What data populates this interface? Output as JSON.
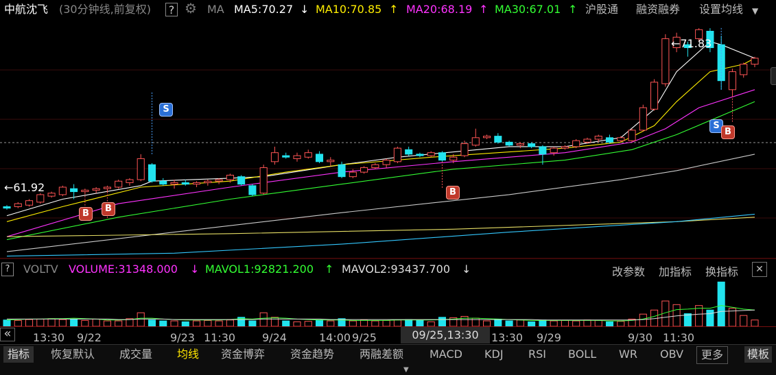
{
  "header": {
    "stock_name": "中航沈飞",
    "period_info": "(30分钟线,前复权)",
    "help": "?",
    "indicator": "MA",
    "ma5": "MA5:70.27",
    "ma10": "MA10:70.85",
    "ma20": "MA20:68.19",
    "ma30": "MA30:67.01",
    "link_hgt": "沪股通",
    "link_margin": "融资融券",
    "link_setma": "设置均线"
  },
  "price_labels": {
    "high": "71.83",
    "low": "61.92"
  },
  "signals": {
    "s": "S",
    "b": "B"
  },
  "vol_header": {
    "help": "?",
    "name": "VOLTV",
    "volume": "VOLUME:31348.000",
    "mavol1": "MAVOL1:92821.200",
    "mavol2": "MAVOL2:93437.700",
    "edit_params": "改参数",
    "add_indicator": "加指标",
    "switch_indicator": "换指标",
    "close": "✕"
  },
  "x_axis": {
    "nav": "«",
    "labels": [
      "13:30",
      "9/22",
      "9/23",
      "11:30",
      "9/24",
      "14:00",
      "9/25",
      "13:30",
      "9/29",
      "9/30",
      "11:30"
    ],
    "cursor": "09/25,13:30"
  },
  "bottom_tabs": [
    "指标",
    "恢复默认",
    "成交量",
    "均线",
    "资金博弈",
    "资金趋势",
    "两融差额",
    "MACD",
    "KDJ",
    "RSI",
    "BOLL",
    "WR",
    "OBV",
    "更多",
    "模板"
  ],
  "colors": {
    "up": "#ff5555",
    "down": "#22e3ee",
    "ma5": "#ffffff",
    "ma10": "#ffee00",
    "ma20": "#ff33ff",
    "ma30": "#33ff33",
    "tab_active": "#ffe600"
  },
  "chart_data": {
    "type": "candlestick",
    "price_range": [
      58.5,
      74.5
    ],
    "candles": [
      [
        62.0,
        62.1,
        61.8,
        61.9
      ],
      [
        62.0,
        62.3,
        61.9,
        62.2
      ],
      [
        62.1,
        62.5,
        62.0,
        62.4
      ],
      [
        62.3,
        62.9,
        62.2,
        62.8
      ],
      [
        62.7,
        63.0,
        62.6,
        62.9
      ],
      [
        62.8,
        63.4,
        62.7,
        63.3
      ],
      [
        63.2,
        63.5,
        62.5,
        63.0
      ],
      [
        63.0,
        63.2,
        62.9,
        63.1
      ],
      [
        63.1,
        63.3,
        62.9,
        63.2
      ],
      [
        63.2,
        63.4,
        63.0,
        63.3
      ],
      [
        63.3,
        63.8,
        63.2,
        63.7
      ],
      [
        63.6,
        63.9,
        63.4,
        63.8
      ],
      [
        63.8,
        65.5,
        63.7,
        65.2
      ],
      [
        64.8,
        64.9,
        63.6,
        63.7
      ],
      [
        63.7,
        63.9,
        63.4,
        63.5
      ],
      [
        63.5,
        63.8,
        63.2,
        63.6
      ],
      [
        63.6,
        63.8,
        63.4,
        63.5
      ],
      [
        63.5,
        63.7,
        63.3,
        63.6
      ],
      [
        63.6,
        63.8,
        63.4,
        63.7
      ],
      [
        63.7,
        63.9,
        63.5,
        63.8
      ],
      [
        63.8,
        64.2,
        63.6,
        64.1
      ],
      [
        64.0,
        64.1,
        63.4,
        63.5
      ],
      [
        63.4,
        63.5,
        62.7,
        62.8
      ],
      [
        62.9,
        64.8,
        62.8,
        64.6
      ],
      [
        65.0,
        66.0,
        64.8,
        65.6
      ],
      [
        65.4,
        65.6,
        65.2,
        65.3
      ],
      [
        65.2,
        65.6,
        65.0,
        65.4
      ],
      [
        65.3,
        65.8,
        65.2,
        65.6
      ],
      [
        65.5,
        65.7,
        64.9,
        65.0
      ],
      [
        65.0,
        65.3,
        64.7,
        65.1
      ],
      [
        64.8,
        65.0,
        63.9,
        64.0
      ],
      [
        64.0,
        64.5,
        63.9,
        64.3
      ],
      [
        64.3,
        64.7,
        64.2,
        64.6
      ],
      [
        64.6,
        64.9,
        64.5,
        64.8
      ],
      [
        64.8,
        65.2,
        64.6,
        65.1
      ],
      [
        65.0,
        66.0,
        64.9,
        65.9
      ],
      [
        65.8,
        66.0,
        65.4,
        65.5
      ],
      [
        65.5,
        65.6,
        65.3,
        65.4
      ],
      [
        65.4,
        65.7,
        65.3,
        65.6
      ],
      [
        65.6,
        65.7,
        65.0,
        65.1
      ],
      [
        65.1,
        65.5,
        64.9,
        65.3
      ],
      [
        65.4,
        66.4,
        65.3,
        66.2
      ],
      [
        66.1,
        67.2,
        66.0,
        66.6
      ],
      [
        66.6,
        66.8,
        66.5,
        66.7
      ],
      [
        66.7,
        66.9,
        66.2,
        66.3
      ],
      [
        66.3,
        66.4,
        66.0,
        66.1
      ],
      [
        66.1,
        66.3,
        65.9,
        66.2
      ],
      [
        66.2,
        66.3,
        65.9,
        66.0
      ],
      [
        66.0,
        66.1,
        64.8,
        65.5
      ],
      [
        65.6,
        66.0,
        65.4,
        65.9
      ],
      [
        65.9,
        66.1,
        65.8,
        66.0
      ],
      [
        66.0,
        66.5,
        65.9,
        66.4
      ],
      [
        66.3,
        66.6,
        66.2,
        66.5
      ],
      [
        66.5,
        66.8,
        66.3,
        66.7
      ],
      [
        66.6,
        66.8,
        66.2,
        66.3
      ],
      [
        66.4,
        66.7,
        66.3,
        66.6
      ],
      [
        66.4,
        67.2,
        66.3,
        67.1
      ],
      [
        67.1,
        68.8,
        67.0,
        68.6
      ],
      [
        68.5,
        70.5,
        68.4,
        70.3
      ],
      [
        70.2,
        73.5,
        70.0,
        73.2
      ],
      [
        72.6,
        73.6,
        72.3,
        73.3
      ],
      [
        72.8,
        73.0,
        72.0,
        72.6
      ],
      [
        73.2,
        73.9,
        73.0,
        73.8
      ],
      [
        73.7,
        73.9,
        72.3,
        72.6
      ],
      [
        72.8,
        73.4,
        69.8,
        70.4
      ],
      [
        69.8,
        71.2,
        69.4,
        71.0
      ],
      [
        70.8,
        71.6,
        70.6,
        71.5
      ],
      [
        71.5,
        72.0,
        71.3,
        71.9
      ]
    ],
    "signals": [
      {
        "type": "S",
        "index": 13,
        "price": 65.5
      },
      {
        "type": "B",
        "index": 7,
        "price": 62.9
      },
      {
        "type": "B",
        "index": 9,
        "price": 63.0
      },
      {
        "type": "B",
        "index": 39,
        "price": 65.0
      },
      {
        "type": "S",
        "index": 64,
        "price": 69.8
      },
      {
        "type": "B",
        "index": 65,
        "price": 69.4
      }
    ],
    "ma_lines": {
      "ma5": [
        [
          0,
          61.4
        ],
        [
          5,
          62.5
        ],
        [
          12,
          63.4
        ],
        [
          13,
          63.7
        ],
        [
          20,
          63.9
        ],
        [
          23,
          64.0
        ],
        [
          30,
          64.8
        ],
        [
          35,
          65.3
        ],
        [
          45,
          66.0
        ],
        [
          50,
          66.0
        ],
        [
          55,
          66.6
        ],
        [
          58,
          68.5
        ],
        [
          60,
          71.0
        ],
        [
          63,
          73.0
        ],
        [
          64,
          72.8
        ],
        [
          67,
          71.9
        ]
      ],
      "ma10": [
        [
          0,
          61.0
        ],
        [
          5,
          62.0
        ],
        [
          12,
          63.3
        ],
        [
          20,
          63.7
        ],
        [
          25,
          64.3
        ],
        [
          30,
          64.8
        ],
        [
          38,
          65.3
        ],
        [
          50,
          65.9
        ],
        [
          55,
          66.3
        ],
        [
          58,
          67.4
        ],
        [
          60,
          69.0
        ],
        [
          63,
          71.0
        ],
        [
          66,
          71.5
        ],
        [
          67,
          71.9
        ]
      ],
      "ma20": [
        [
          0,
          60.0
        ],
        [
          10,
          62.2
        ],
        [
          20,
          63.3
        ],
        [
          30,
          64.3
        ],
        [
          40,
          65.0
        ],
        [
          50,
          65.6
        ],
        [
          56,
          66.3
        ],
        [
          59,
          67.2
        ],
        [
          62,
          68.6
        ],
        [
          67,
          69.8
        ]
      ],
      "ma30": [
        [
          0,
          59.8
        ],
        [
          10,
          61.3
        ],
        [
          20,
          62.5
        ],
        [
          30,
          63.5
        ],
        [
          40,
          64.5
        ],
        [
          50,
          65.1
        ],
        [
          56,
          65.8
        ],
        [
          60,
          66.8
        ],
        [
          67,
          69.0
        ]
      ],
      "ma60": [
        [
          0,
          59.0
        ],
        [
          15,
          60.3
        ],
        [
          30,
          61.6
        ],
        [
          45,
          62.8
        ],
        [
          55,
          63.8
        ],
        [
          60,
          64.4
        ],
        [
          67,
          65.5
        ]
      ],
      "ma120": [
        [
          0,
          60.0
        ],
        [
          20,
          60.2
        ],
        [
          40,
          60.5
        ],
        [
          60,
          61.0
        ],
        [
          67,
          61.3
        ]
      ],
      "ma250": [
        [
          0,
          58.7
        ],
        [
          15,
          58.9
        ],
        [
          30,
          59.5
        ],
        [
          45,
          60.3
        ],
        [
          60,
          61.0
        ],
        [
          67,
          61.5
        ]
      ]
    },
    "ma_colors": {
      "ma5": "#ffffff",
      "ma10": "#ffee00",
      "ma20": "#ff33ff",
      "ma30": "#33ff33",
      "ma60": "#cccccc",
      "ma120": "#e8e066",
      "ma250": "#33c8ff"
    },
    "volume": [
      0.14,
      0.13,
      0.15,
      0.16,
      0.17,
      0.15,
      0.16,
      0.13,
      0.16,
      0.12,
      0.12,
      0.17,
      0.3,
      0.14,
      0.12,
      0.12,
      0.1,
      0.12,
      0.13,
      0.12,
      0.14,
      0.2,
      0.12,
      0.3,
      0.2,
      0.12,
      0.1,
      0.11,
      0.14,
      0.12,
      0.17,
      0.12,
      0.14,
      0.12,
      0.13,
      0.14,
      0.15,
      0.13,
      0.1,
      0.2,
      0.19,
      0.22,
      0.18,
      0.12,
      0.16,
      0.12,
      0.14,
      0.1,
      0.14,
      0.12,
      0.13,
      0.12,
      0.14,
      0.13,
      0.1,
      0.11,
      0.16,
      0.27,
      0.36,
      0.56,
      0.48,
      0.28,
      0.46,
      0.36,
      0.98,
      0.4,
      0.24,
      0.14
    ],
    "mavol1": [
      0.14,
      0.15,
      0.16,
      0.16,
      0.17,
      0.17,
      0.18,
      0.17,
      0.16,
      0.14,
      0.14,
      0.15,
      0.18,
      0.18,
      0.16,
      0.15,
      0.14,
      0.14,
      0.14,
      0.14,
      0.15,
      0.17,
      0.16,
      0.18,
      0.19,
      0.18,
      0.16,
      0.15,
      0.14,
      0.14,
      0.14,
      0.13,
      0.13,
      0.13,
      0.13,
      0.14,
      0.14,
      0.14,
      0.14,
      0.15,
      0.16,
      0.18,
      0.18,
      0.17,
      0.16,
      0.15,
      0.14,
      0.13,
      0.13,
      0.13,
      0.13,
      0.13,
      0.13,
      0.13,
      0.12,
      0.12,
      0.13,
      0.16,
      0.22,
      0.3,
      0.37,
      0.38,
      0.4,
      0.4,
      0.46,
      0.42,
      0.38,
      0.36
    ],
    "mavol2": [
      0.16,
      0.16,
      0.16,
      0.16,
      0.16,
      0.16,
      0.16,
      0.16,
      0.16,
      0.16,
      0.15,
      0.15,
      0.16,
      0.16,
      0.16,
      0.15,
      0.15,
      0.15,
      0.15,
      0.15,
      0.15,
      0.15,
      0.15,
      0.16,
      0.16,
      0.16,
      0.16,
      0.16,
      0.16,
      0.15,
      0.15,
      0.15,
      0.15,
      0.15,
      0.15,
      0.15,
      0.15,
      0.15,
      0.15,
      0.15,
      0.15,
      0.15,
      0.15,
      0.15,
      0.15,
      0.15,
      0.15,
      0.15,
      0.14,
      0.14,
      0.14,
      0.14,
      0.14,
      0.14,
      0.14,
      0.14,
      0.14,
      0.15,
      0.17,
      0.2,
      0.23,
      0.25,
      0.27,
      0.28,
      0.33,
      0.34,
      0.35,
      0.36
    ]
  }
}
